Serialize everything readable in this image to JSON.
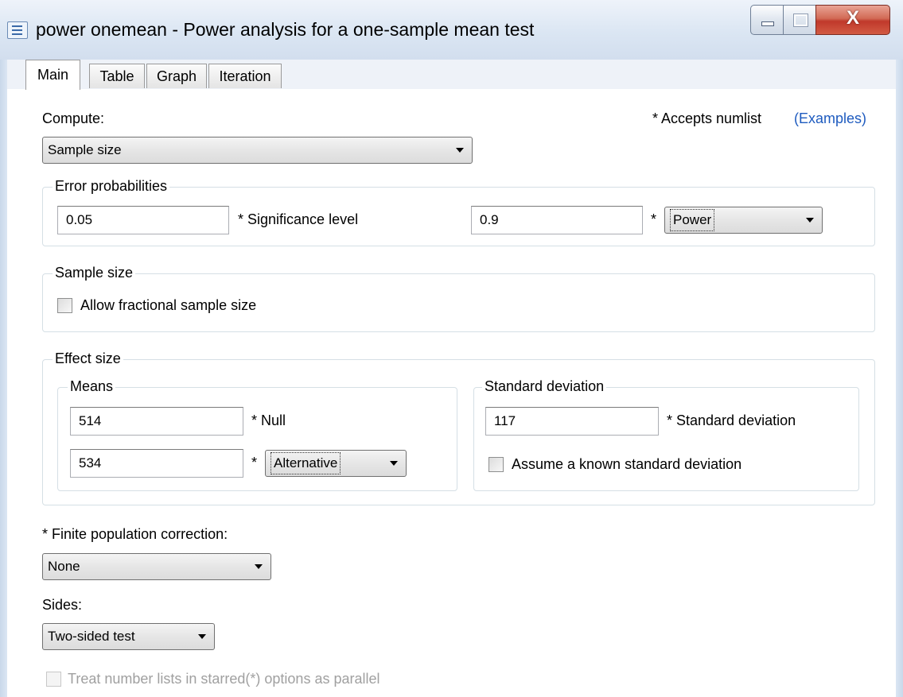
{
  "window": {
    "title": "power onemean - Power analysis for a one-sample mean test",
    "close_glyph": "X"
  },
  "tabs": [
    {
      "label": "Main",
      "active": true
    },
    {
      "label": "Table",
      "active": false
    },
    {
      "label": "Graph",
      "active": false
    },
    {
      "label": "Iteration",
      "active": false
    }
  ],
  "compute": {
    "label": "Compute:",
    "value": "Sample size",
    "note": "* Accepts numlist",
    "examples_link": "(Examples)"
  },
  "error_probabilities": {
    "title": "Error probabilities",
    "significance_value": "0.05",
    "significance_label": "* Significance level",
    "power_value": "0.9",
    "power_star": "*",
    "power_select": "Power"
  },
  "sample_size": {
    "title": "Sample size",
    "fractional_label": "Allow fractional sample size",
    "fractional_checked": false
  },
  "effect_size": {
    "title": "Effect size",
    "means": {
      "title": "Means",
      "null_value": "514",
      "null_label": "* Null",
      "alt_value": "534",
      "alt_star": "*",
      "alt_select": "Alternative"
    },
    "std_dev": {
      "title": "Standard deviation",
      "value": "117",
      "label": "* Standard deviation",
      "known_label": "Assume a known standard deviation",
      "known_checked": false
    }
  },
  "fpc": {
    "label": "* Finite population correction:",
    "value": "None"
  },
  "sides": {
    "label": "Sides:",
    "value": "Two-sided test"
  },
  "parallel": {
    "label": "Treat number lists in starred(*) options as parallel",
    "checked": false,
    "enabled": false
  }
}
